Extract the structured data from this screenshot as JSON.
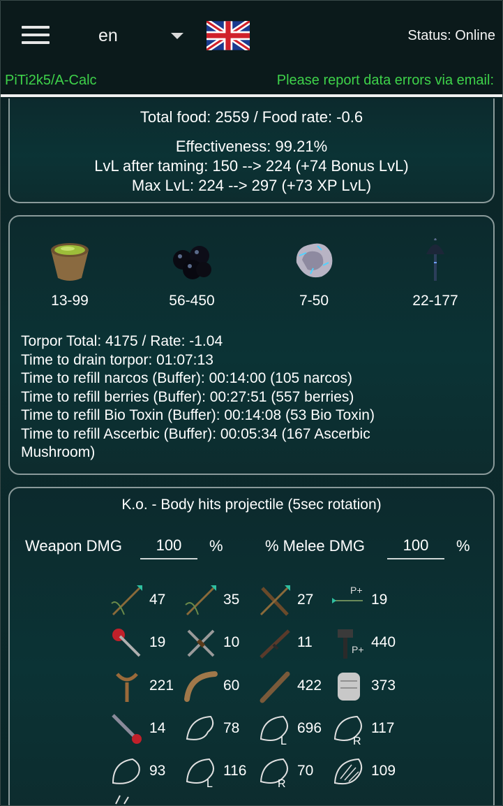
{
  "header": {
    "language": "en",
    "status": "Status: Online",
    "app_link": "PiTi2k5/A-Calc",
    "report_text": "Please report data errors via email:"
  },
  "summary": {
    "food_line": "Total food: 2559 / Food rate: -0.6",
    "effectiveness": "Effectiveness: 99.21%",
    "lvl_after": "LvL after taming: 150 --> 224 (+74 Bonus LvL)",
    "max_lvl": "Max LvL: 224 --> 297 (+73 XP LvL)"
  },
  "torpor_items": [
    {
      "icon": "narcotic-bowl-icon",
      "range": "13-99"
    },
    {
      "icon": "narcoberry-icon",
      "range": "56-450"
    },
    {
      "icon": "bio-toxin-icon",
      "range": "7-50"
    },
    {
      "icon": "ascerbic-mushroom-icon",
      "range": "22-177"
    }
  ],
  "torpor": {
    "total": "Torpor Total: 4175 / Rate: -1.04",
    "drain": "Time to drain torpor: 01:07:13",
    "narcos": "Time to refill narcos (Buffer): 00:14:00 (105 narcos)",
    "berries": "Time to refill berries (Buffer): 00:27:51 (557 berries)",
    "biotoxin": "Time to refill Bio Toxin (Buffer): 00:14:08 (53 Bio Toxin)",
    "ascerbic_1": "Time to refill Ascerbic (Buffer): 00:05:34 (167 Ascerbic",
    "ascerbic_2": "Mushroom)"
  },
  "ko": {
    "title": "K.o. - Body hits projectile (5sec rotation)",
    "weapon_label": "Weapon DMG",
    "weapon_value": "100",
    "weapon_unit": "%",
    "melee_label": "% Melee DMG",
    "melee_value": "100",
    "melee_unit": "%",
    "weapons": [
      {
        "icon": "tranq-arrow-icon",
        "value": "47"
      },
      {
        "icon": "tranq-arrow-crossbow-icon",
        "value": "35"
      },
      {
        "icon": "tranq-arrow-compound-icon",
        "value": "27"
      },
      {
        "icon": "tranq-arrow-primitive-plus-icon",
        "value": "19"
      },
      {
        "icon": "tranq-dart-icon",
        "value": "19"
      },
      {
        "icon": "crossbow-icon",
        "value": "10"
      },
      {
        "icon": "longneck-rifle-icon",
        "value": "11"
      },
      {
        "icon": "hammer-primitive-plus-icon",
        "value": "440"
      },
      {
        "icon": "slingshot-icon",
        "value": "221"
      },
      {
        "icon": "boomerang-icon",
        "value": "60"
      },
      {
        "icon": "wooden-club-icon",
        "value": "422"
      },
      {
        "icon": "fist-icon",
        "value": "373"
      },
      {
        "icon": "shocking-tranq-dart-icon",
        "value": "14"
      },
      {
        "icon": "creature-bite-icon",
        "value": "78"
      },
      {
        "icon": "creature-left-icon",
        "value": "696"
      },
      {
        "icon": "creature-right-icon",
        "value": "117"
      },
      {
        "icon": "creature-head-icon",
        "value": "93"
      },
      {
        "icon": "creature-left-2-icon",
        "value": "116"
      },
      {
        "icon": "creature-right-2-icon",
        "value": "70"
      },
      {
        "icon": "creature-skeleton-icon",
        "value": "109"
      }
    ]
  }
}
